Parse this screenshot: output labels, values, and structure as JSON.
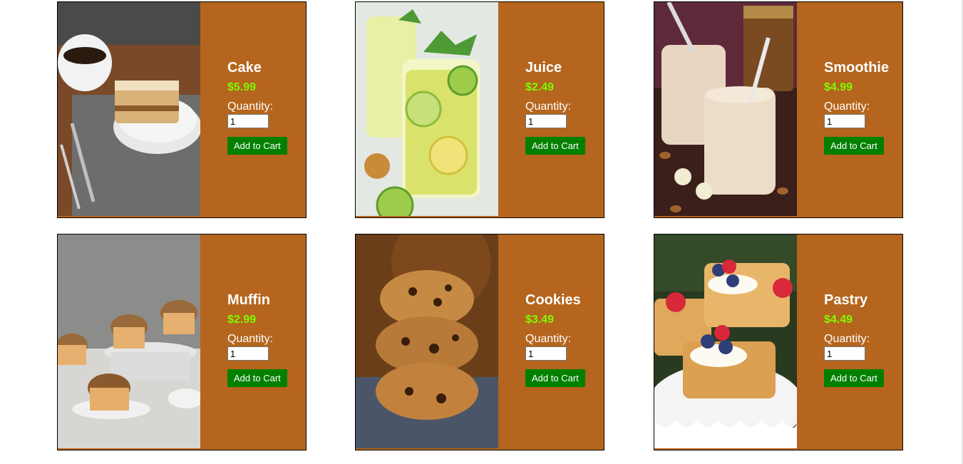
{
  "colors": {
    "card_bg": "#b5651d",
    "price": "#7CFC00",
    "button": "#008000"
  },
  "products": [
    {
      "name": "Cake",
      "price": "$5.99",
      "quantity_label": "Quantity:",
      "quantity_value": "1",
      "button_label": "Add to Cart",
      "image": "cake-photo"
    },
    {
      "name": "Juice",
      "price": "$2.49",
      "quantity_label": "Quantity:",
      "quantity_value": "1",
      "button_label": "Add to Cart",
      "image": "juice-photo"
    },
    {
      "name": "Smoothie",
      "price": "$4.99",
      "quantity_label": "Quantity:",
      "quantity_value": "1",
      "button_label": "Add to Cart",
      "image": "smoothie-photo"
    },
    {
      "name": "Muffin",
      "price": "$2.99",
      "quantity_label": "Quantity:",
      "quantity_value": "1",
      "button_label": "Add to Cart",
      "image": "muffin-photo"
    },
    {
      "name": "Cookies",
      "price": "$3.49",
      "quantity_label": "Quantity:",
      "quantity_value": "1",
      "button_label": "Add to Cart",
      "image": "cookies-photo"
    },
    {
      "name": "Pastry",
      "price": "$4.49",
      "quantity_label": "Quantity:",
      "quantity_value": "1",
      "button_label": "Add to Cart",
      "image": "pastry-photo"
    }
  ]
}
